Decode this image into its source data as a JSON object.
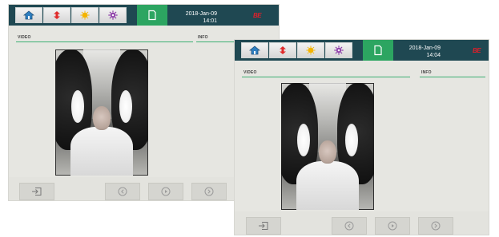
{
  "screens": [
    {
      "datetime": {
        "date": "2018-Jan-09",
        "time": "14:01"
      },
      "brand": "BE",
      "sections": {
        "video_label": "VIDEO",
        "info_label": "INFO"
      }
    },
    {
      "datetime": {
        "date": "2018-Jan-09",
        "time": "14:04"
      },
      "brand": "BE",
      "sections": {
        "video_label": "VIDEO",
        "info_label": "INFO"
      }
    }
  ],
  "icons": {
    "nav": [
      "home-icon",
      "swap-icon",
      "sun-icon",
      "gear-icon",
      "page-icon"
    ],
    "controls": [
      "exit-icon",
      "previous-icon",
      "play-icon",
      "next-icon"
    ]
  },
  "colors": {
    "topbar": "#1f4852",
    "active_tab": "#2ca561",
    "divider": "#3caf73",
    "brand": "#e01f2a"
  }
}
